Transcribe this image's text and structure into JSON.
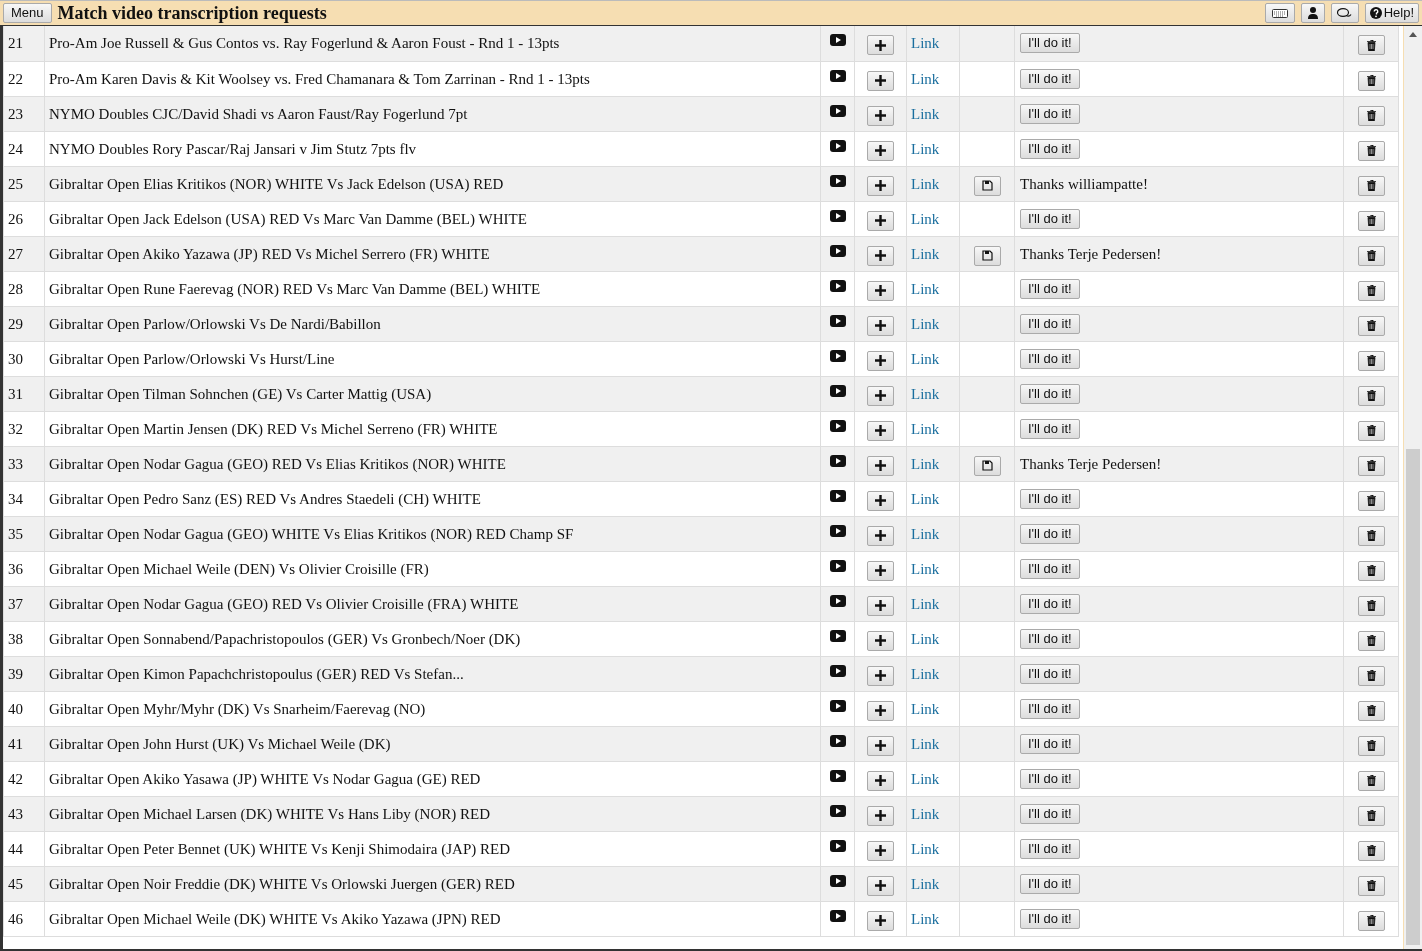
{
  "header": {
    "menu_button": "Menu",
    "title": "Match video transcription requests",
    "help_button": "Help!"
  },
  "rows": [
    {
      "number": "21",
      "title": "Pro-Am Joe Russell & Gus Contos vs. Ray Fogerlund & Aaron Foust - Rnd 1 - 13pts",
      "link": "Link",
      "kind": "open",
      "action": "I'll do it!"
    },
    {
      "number": "22",
      "title": "Pro-Am Karen Davis & Kit Woolsey vs. Fred Chamanara & Tom Zarrinan - Rnd 1 - 13pts",
      "link": "Link",
      "kind": "open",
      "action": "I'll do it!"
    },
    {
      "number": "23",
      "title": "NYMO Doubles CJC/David Shadi vs Aaron Faust/Ray Fogerlund 7pt",
      "link": "Link",
      "kind": "open",
      "action": "I'll do it!"
    },
    {
      "number": "24",
      "title": "NYMO Doubles Rory Pascar/Raj Jansari v Jim Stutz 7pts flv",
      "link": "Link",
      "kind": "open",
      "action": "I'll do it!"
    },
    {
      "number": "25",
      "title": "Gibraltar Open Elias Kritikos (NOR) WHITE Vs Jack Edelson (USA) RED",
      "link": "Link",
      "kind": "claimed",
      "action": "Thanks williampatte!"
    },
    {
      "number": "26",
      "title": "Gibraltar Open Jack Edelson (USA) RED Vs Marc Van Damme (BEL) WHITE",
      "link": "Link",
      "kind": "open",
      "action": "I'll do it!"
    },
    {
      "number": "27",
      "title": "Gibraltar Open Akiko Yazawa (JP) RED Vs Michel Serrero (FR) WHITE",
      "link": "Link",
      "kind": "claimed",
      "action": "Thanks Terje Pedersen!"
    },
    {
      "number": "28",
      "title": "Gibraltar Open Rune Faerevag (NOR) RED Vs Marc Van Damme (BEL) WHITE",
      "link": "Link",
      "kind": "open",
      "action": "I'll do it!"
    },
    {
      "number": "29",
      "title": "Gibraltar Open Parlow/Orlowski Vs De Nardi/Babillon",
      "link": "Link",
      "kind": "open",
      "action": "I'll do it!"
    },
    {
      "number": "30",
      "title": "Gibraltar Open Parlow/Orlowski Vs Hurst/Line",
      "link": "Link",
      "kind": "open",
      "action": "I'll do it!"
    },
    {
      "number": "31",
      "title": "Gibraltar Open Tilman Sohnchen (GE) Vs Carter Mattig (USA)",
      "link": "Link",
      "kind": "open",
      "action": "I'll do it!"
    },
    {
      "number": "32",
      "title": "Gibraltar Open Martin Jensen (DK) RED Vs Michel Serreno (FR) WHITE",
      "link": "Link",
      "kind": "open",
      "action": "I'll do it!"
    },
    {
      "number": "33",
      "title": "Gibraltar Open Nodar Gagua (GEO) RED Vs Elias Kritikos (NOR) WHITE",
      "link": "Link",
      "kind": "claimed",
      "action": "Thanks Terje Pedersen!"
    },
    {
      "number": "34",
      "title": "Gibraltar Open Pedro Sanz (ES) RED Vs Andres Staedeli (CH) WHITE",
      "link": "Link",
      "kind": "open",
      "action": "I'll do it!"
    },
    {
      "number": "35",
      "title": "Gibraltar Open Nodar Gagua (GEO) WHITE Vs Elias Kritikos (NOR) RED Champ SF",
      "link": "Link",
      "kind": "open",
      "action": "I'll do it!"
    },
    {
      "number": "36",
      "title": "Gibraltar Open Michael Weile (DEN) Vs Olivier Croisille (FR)",
      "link": "Link",
      "kind": "open",
      "action": "I'll do it!"
    },
    {
      "number": "37",
      "title": "Gibraltar Open Nodar Gagua (GEO) RED Vs Olivier Croisille (FRA) WHITE",
      "link": "Link",
      "kind": "open",
      "action": "I'll do it!"
    },
    {
      "number": "38",
      "title": "Gibraltar Open Sonnabend/Papachristopoulos (GER) Vs Gronbech/Noer (DK)",
      "link": "Link",
      "kind": "open",
      "action": "I'll do it!"
    },
    {
      "number": "39",
      "title": "Gibraltar Open Kimon Papachchristopoulus (GER) RED Vs Stefan...",
      "link": "Link",
      "kind": "open",
      "action": "I'll do it!"
    },
    {
      "number": "40",
      "title": "Gibraltar Open Myhr/Myhr (DK) Vs Snarheim/Faerevag (NO)",
      "link": "Link",
      "kind": "open",
      "action": "I'll do it!"
    },
    {
      "number": "41",
      "title": "Gibraltar Open John Hurst (UK) Vs Michael Weile (DK)",
      "link": "Link",
      "kind": "open",
      "action": "I'll do it!"
    },
    {
      "number": "42",
      "title": "Gibraltar Open Akiko Yasawa (JP) WHITE Vs Nodar Gagua (GE) RED",
      "link": "Link",
      "kind": "open",
      "action": "I'll do it!"
    },
    {
      "number": "43",
      "title": "Gibraltar Open Michael Larsen (DK) WHITE Vs Hans Liby (NOR) RED",
      "link": "Link",
      "kind": "open",
      "action": "I'll do it!"
    },
    {
      "number": "44",
      "title": "Gibraltar Open Peter Bennet (UK) WHITE Vs Kenji Shimodaira (JAP) RED",
      "link": "Link",
      "kind": "open",
      "action": "I'll do it!"
    },
    {
      "number": "45",
      "title": "Gibraltar Open Noir Freddie (DK) WHITE Vs Orlowski Juergen (GER) RED",
      "link": "Link",
      "kind": "open",
      "action": "I'll do it!"
    },
    {
      "number": "46",
      "title": "Gibraltar Open Michael Weile (DK) WHITE Vs Akiko Yazawa (JPN) RED",
      "link": "Link",
      "kind": "open",
      "action": "I'll do it!"
    }
  ]
}
